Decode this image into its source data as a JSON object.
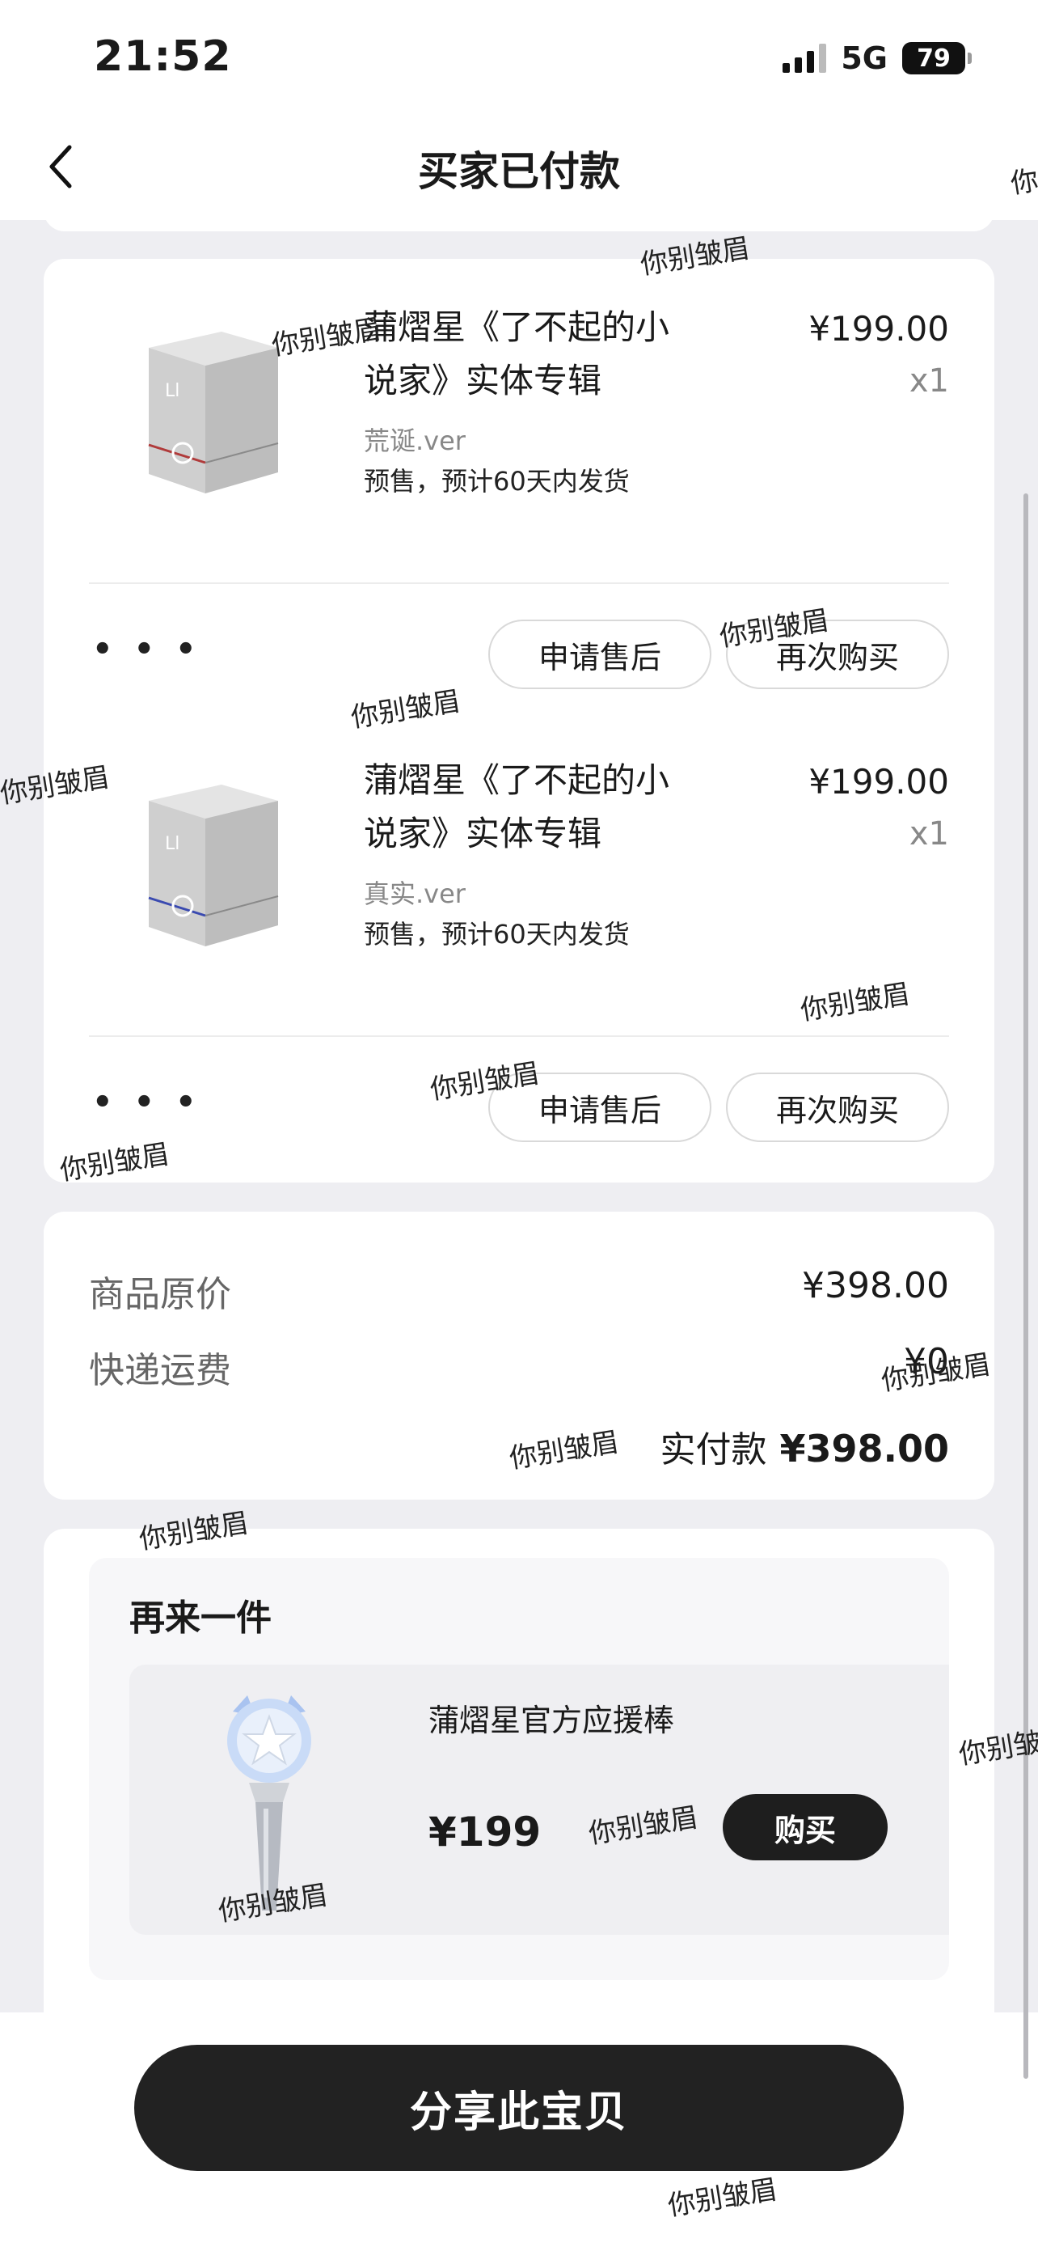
{
  "status_bar": {
    "time": "21:52",
    "network": "5G",
    "battery": "79"
  },
  "header": {
    "title": "买家已付款",
    "back_icon": "chevron-left-icon"
  },
  "order_items": [
    {
      "name_line1": "蒲熠星《了不起的小",
      "name_line2": "说家》实体专辑",
      "price": "¥199.00",
      "qty": "x1",
      "variant": "荒诞.ver",
      "shipping_note": "预售，预计60天内发货",
      "more_label": "• • •",
      "after_sales_label": "申请售后",
      "rebuy_label": "再次购买"
    },
    {
      "name_line1": "蒲熠星《了不起的小",
      "name_line2": "说家》实体专辑",
      "price": "¥199.00",
      "qty": "x1",
      "variant": "真实.ver",
      "shipping_note": "预售，预计60天内发货",
      "more_label": "• • •",
      "after_sales_label": "申请售后",
      "rebuy_label": "再次购买"
    }
  ],
  "summary": {
    "original_price_label": "商品原价",
    "original_price_value": "¥398.00",
    "shipping_label": "快递运费",
    "shipping_value": "¥0",
    "paid_label": "实付款",
    "paid_value": "¥398.00"
  },
  "recommend": {
    "title": "再来一件",
    "product_name": "蒲熠星官方应援棒",
    "product_price": "¥199",
    "buy_label": "购买"
  },
  "bottom": {
    "share_label": "分享此宝贝"
  },
  "watermark": {
    "text": "你别皱眉",
    "partial_text": "你"
  }
}
